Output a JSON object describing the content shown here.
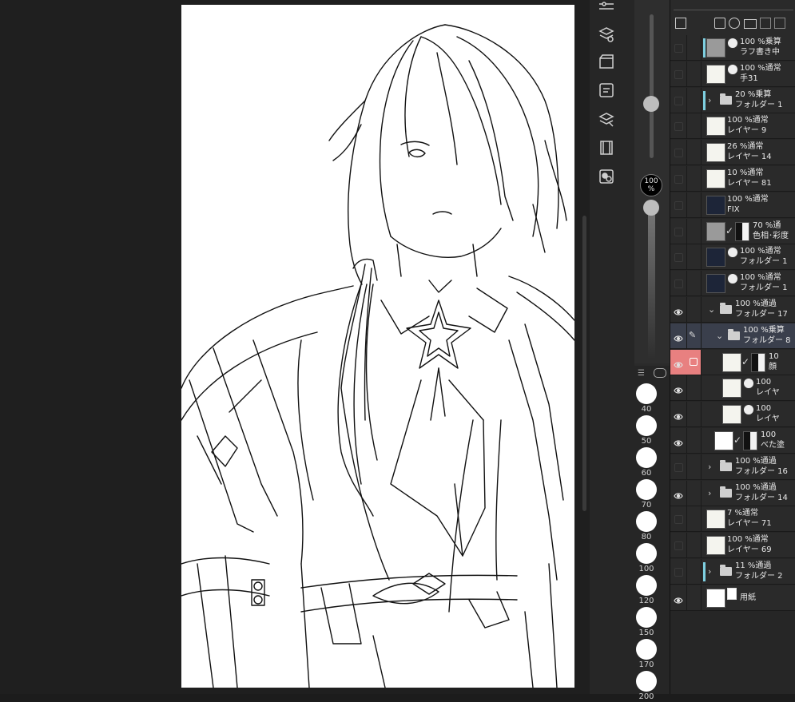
{
  "opacity_readout": {
    "value": "100",
    "unit": "%"
  },
  "brush_sizes": [
    "40",
    "50",
    "60",
    "70",
    "80",
    "100",
    "120",
    "150",
    "170",
    "200"
  ],
  "layers": [
    {
      "mode": "100 %乗算",
      "name": "ラフ書き中",
      "type": "layer"
    },
    {
      "mode": "100 %通常",
      "name": "手31",
      "type": "layer"
    },
    {
      "mode": "20 %乗算",
      "name": "フォルダー 1",
      "type": "folder"
    },
    {
      "mode": "100 %通常",
      "name": "レイヤー 9",
      "type": "layer"
    },
    {
      "mode": "26 %通常",
      "name": "レイヤー 14",
      "type": "layer"
    },
    {
      "mode": "10 %通常",
      "name": "レイヤー 81",
      "type": "layer"
    },
    {
      "mode": "100 %通常",
      "name": "FIX",
      "type": "layer"
    },
    {
      "mode": "70 %通",
      "name": "色相･彩度",
      "type": "correction"
    },
    {
      "mode": "100 %通常",
      "name": "フォルダー 1",
      "type": "layer"
    },
    {
      "mode": "100 %通常",
      "name": "フォルダー 1",
      "type": "layer"
    },
    {
      "mode": "100 %通過",
      "name": "フォルダー 17",
      "type": "folder-open"
    },
    {
      "mode": "100 %乗算",
      "name": "フォルダー 8",
      "type": "folder-open"
    },
    {
      "mode": "10",
      "name": "顔",
      "type": "layer"
    },
    {
      "mode": "100",
      "name": "レイヤ",
      "type": "layer"
    },
    {
      "mode": "100",
      "name": "レイヤ",
      "type": "layer"
    },
    {
      "mode": "100",
      "name": "べた塗",
      "type": "layer"
    },
    {
      "mode": "100 %通過",
      "name": "フォルダー 16",
      "type": "folder"
    },
    {
      "mode": "100 %通過",
      "name": "フォルダー 14",
      "type": "folder"
    },
    {
      "mode": "7 %通常",
      "name": "レイヤー 71",
      "type": "layer"
    },
    {
      "mode": "100 %通常",
      "name": "レイヤー 69",
      "type": "layer"
    },
    {
      "mode": "11 %通過",
      "name": "フォルダー 2",
      "type": "folder"
    },
    {
      "mode": "",
      "name": "用紙",
      "type": "paper"
    }
  ],
  "colors": {
    "selected_row": "#3a3f4c",
    "active_cell": "#e88080",
    "folder_tag": "#7ecfe0"
  }
}
